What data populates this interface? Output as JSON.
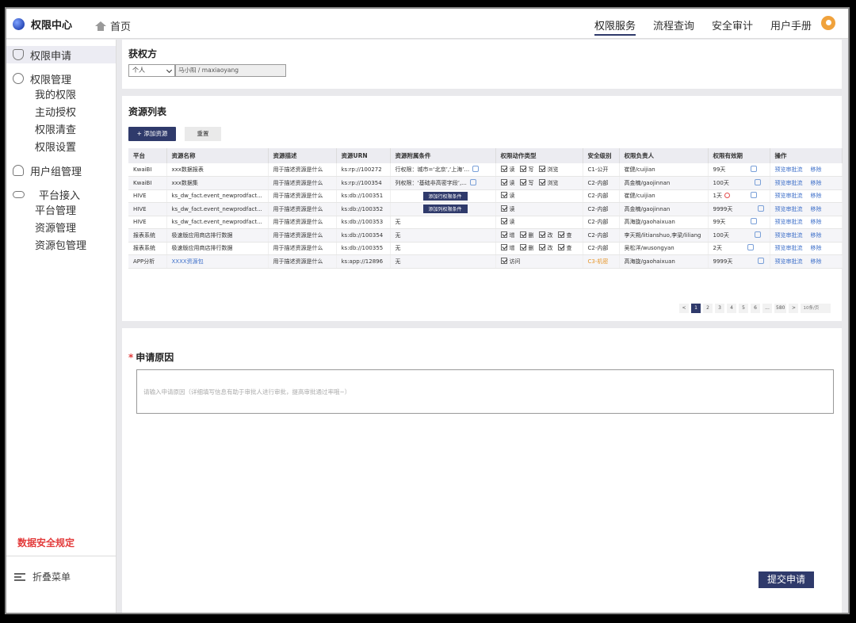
{
  "app": {
    "title": "权限中心",
    "home": "首页"
  },
  "topnav": [
    "权限服务",
    "流程查询",
    "安全审计",
    "用户手册"
  ],
  "sidebar": {
    "apply": "权限申请",
    "manage": "权限管理",
    "manage_sub": [
      "我的权限",
      "主动授权",
      "权限清查",
      "权限设置"
    ],
    "group": "用户组管理",
    "platform": "平台接入",
    "platform_sub": [
      "平台管理",
      "资源管理",
      "资源包管理"
    ],
    "rule": "数据安全规定",
    "collapse": "折叠菜单"
  },
  "grantee": {
    "title": "获权方",
    "type": "个人",
    "name": "马小阳 / maxiaoyang"
  },
  "resources": {
    "title": "资源列表",
    "add_button": "+ 添加资源",
    "reset_button": "重置",
    "columns": [
      "平台",
      "资源名称",
      "资源描述",
      "资源URN",
      "资源附属条件",
      "权限动作类型",
      "安全级别",
      "权限负责人",
      "权限有效期",
      "操作"
    ],
    "rows": [
      {
        "platform": "KwaiBI",
        "name": "xxx数据报表",
        "desc": "用于描述资源是什么",
        "urn": "ks:rp://100272",
        "cond": "行权限：城市=‘北京’,‘上海’...",
        "perms": [
          "读",
          "写",
          "浏览"
        ],
        "level": "C1-公开",
        "owner": "崔健/cuijian",
        "expire": "99天"
      },
      {
        "platform": "KwaiBI",
        "name": "xxx数据集",
        "desc": "用于描述资源是什么",
        "urn": "ks:rp://100354",
        "cond": "列权限：‘基础非高密字段’,...",
        "perms": [
          "读",
          "写",
          "浏览"
        ],
        "level": "C2-内部",
        "owner": "高金楠/gaojinnan",
        "expire": "100天"
      },
      {
        "platform": "HIVE",
        "name": "ks_dw_fact.event_newprodfact...",
        "desc": "用于描述资源是什么",
        "urn": "ks:db://100351",
        "cond_button": "添加行权限条件",
        "perms": [
          "读"
        ],
        "level": "C2-内部",
        "owner": "崔健/cuijian",
        "expire": "1天"
      },
      {
        "platform": "HIVE",
        "name": "ks_dw_fact.event_newprodfact...",
        "desc": "用于描述资源是什么",
        "urn": "ks:db://100352",
        "cond_button": "添加列权限条件",
        "perms": [
          "读"
        ],
        "level": "C2-内部",
        "owner": "高金楠/gaojinnan",
        "expire": "9999天"
      },
      {
        "platform": "HIVE",
        "name": "ks_dw_fact.event_newprodfact...",
        "desc": "用于描述资源是什么",
        "urn": "ks:db://100353",
        "cond": "无",
        "perms": [
          "读"
        ],
        "level": "C2-内部",
        "owner": "高海旋/gaohaixuan",
        "expire": "99天"
      },
      {
        "platform": "报表系统",
        "name": "极速版应用商店排行数据",
        "desc": "用于描述资源是什么",
        "urn": "ks:db://100354",
        "cond": "无",
        "perms": [
          "增",
          "删",
          "改",
          "查"
        ],
        "level": "C2-内部",
        "owner": "李天朔/litianshuo,李梁/liliang",
        "expire": "100天"
      },
      {
        "platform": "报表系统",
        "name": "极速版应用商店排行数据",
        "desc": "用于描述资源是什么",
        "urn": "ks:db://100355",
        "cond": "无",
        "perms": [
          "增",
          "删",
          "改",
          "查"
        ],
        "level": "C2-内部",
        "owner": "吴松洋/wusongyan",
        "expire": "2天"
      },
      {
        "platform": "APP分析",
        "name": "XXXX资源包",
        "desc": "用于描述资源是什么",
        "urn": "ks:app://12896",
        "cond": "无",
        "perms": [
          "访问"
        ],
        "level": "C3-机密",
        "owner": "高海旋/gaohaixuan",
        "expire": "9999天"
      }
    ],
    "actions": {
      "preview": "预览审批流",
      "remove": "移除"
    },
    "pager": {
      "prev": "<",
      "pages": [
        "1",
        "2",
        "3",
        "4",
        "5",
        "6"
      ],
      "ellipsis": "...",
      "last": "580",
      "next": ">",
      "jump": "10条/页"
    }
  },
  "reason": {
    "title": "申请原因",
    "placeholder": "请输入申请原因（详细填写信息有助于审批人进行审批，提高审批通过率哦~）"
  },
  "submit": "提交申请",
  "colors": {
    "primary": "#2f3a6b",
    "danger": "#e33b3b",
    "link": "#3d6fc9",
    "warning": "#e6962a"
  }
}
